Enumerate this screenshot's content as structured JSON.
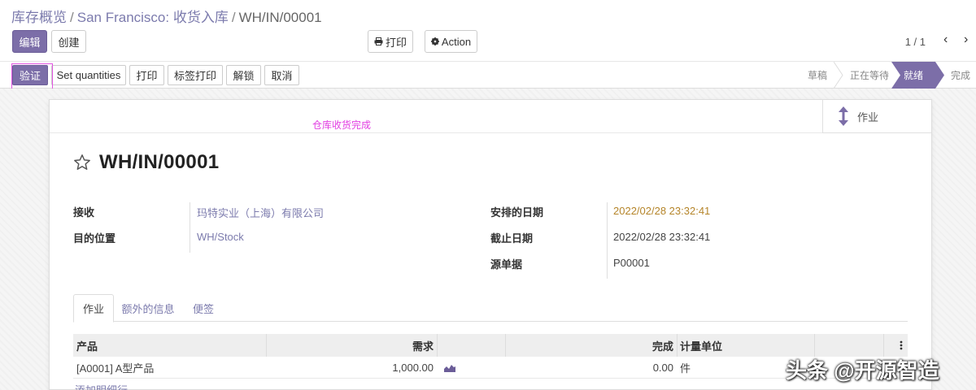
{
  "breadcrumb": {
    "root": "库存概览",
    "middle": "San Francisco: 收货入库",
    "current": "WH/IN/00001",
    "separator": "/"
  },
  "toolbar": {
    "edit_label": "编辑",
    "create_label": "创建",
    "print_label": "打印",
    "action_label": "Action"
  },
  "pager": {
    "value": "1 / 1",
    "prev": "‹",
    "next": "›"
  },
  "statusbar": {
    "buttons": [
      "验证",
      "Set quantities",
      "打印",
      "标签打印",
      "解锁",
      "取消"
    ],
    "stages": [
      "草稿",
      "正在等待",
      "就绪",
      "完成"
    ],
    "active_stage": "就绪"
  },
  "annotation": "仓库收货完成",
  "smart_button": {
    "label": "作业",
    "icon": "up-down-arrow-icon"
  },
  "record": {
    "title": "WH/IN/00001",
    "fields_left": [
      {
        "label": "接收",
        "value": "玛特实业（上海）有限公司"
      },
      {
        "label": "目的位置",
        "value": "WH/Stock"
      }
    ],
    "fields_right": [
      {
        "label": "安排的日期",
        "value": "2022/02/28 23:32:41"
      },
      {
        "label": "截止日期",
        "value": "2022/02/28 23:32:41"
      },
      {
        "label": "源单据",
        "value": "P00001"
      }
    ]
  },
  "tabs": [
    "作业",
    "额外的信息",
    "便签"
  ],
  "table": {
    "columns": [
      "产品",
      "需求",
      "完成",
      "计量单位"
    ],
    "rows": [
      {
        "product": "[A0001] A型产品",
        "demand": "1,000.00",
        "done": "0.00",
        "uom": "件"
      }
    ],
    "add_line": "添加明细行"
  },
  "watermark": "头条 @开源智造",
  "colors": {
    "primary": "#7c6ea8",
    "link": "#7c7bad",
    "warning_date": "#b5852a",
    "annotation": "#e23ee2"
  }
}
